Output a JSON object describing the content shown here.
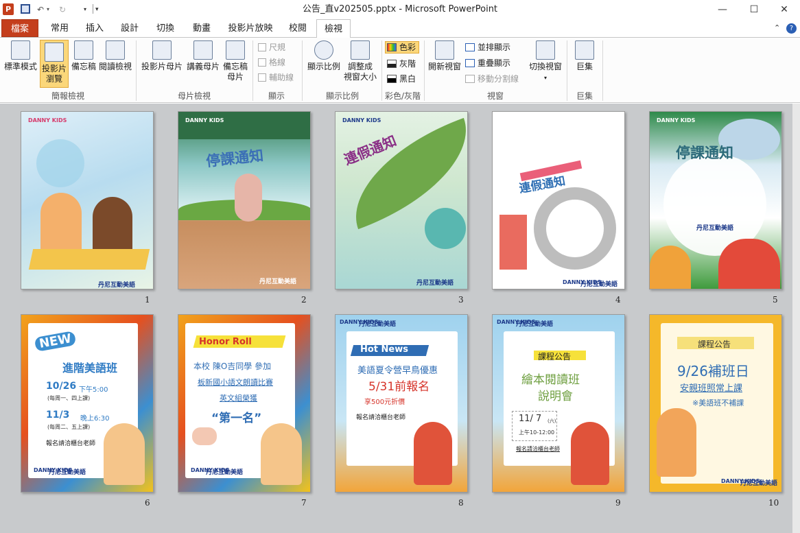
{
  "titlebar": {
    "title": "公告_直v202505.pptx  -  Microsoft PowerPoint",
    "minimize": "—",
    "maximize": "☐",
    "close": "✕"
  },
  "tabs": [
    {
      "label": "檔案"
    },
    {
      "label": "常用"
    },
    {
      "label": "插入"
    },
    {
      "label": "設計"
    },
    {
      "label": "切換"
    },
    {
      "label": "動畫"
    },
    {
      "label": "投影片放映"
    },
    {
      "label": "校閱"
    },
    {
      "label": "檢視"
    }
  ],
  "ribbon": {
    "presentation_views": {
      "label": "簡報檢視",
      "normal": "標準模式",
      "sorter_line1": "投影片",
      "sorter_line2": "瀏覽",
      "notes": "備忘稿",
      "reading": "閱讀檢視"
    },
    "master_views": {
      "label": "母片檢視",
      "slide_master": "投影片母片",
      "handout_master": "講義母片",
      "notes_master_line1": "備忘稿",
      "notes_master_line2": "母片"
    },
    "show": {
      "label": "顯示",
      "ruler": "尺規",
      "gridlines": "格線",
      "guides": "輔助線"
    },
    "zoom": {
      "label": "顯示比例",
      "zoom": "顯示比例",
      "fit_line1": "調整成",
      "fit_line2": "視窗大小"
    },
    "color": {
      "label": "彩色/灰階",
      "color": "色彩",
      "grayscale": "灰階",
      "bw": "黑白"
    },
    "window": {
      "label": "視窗",
      "new_window": "開新視窗",
      "arrange_all": "並排顯示",
      "cascade": "重疊顯示",
      "move_split": "移動分割線",
      "switch": "切換視窗"
    },
    "macros": {
      "label": "巨集",
      "macros": "巨集"
    }
  },
  "slides": [
    {
      "num": "1",
      "brand": "丹尼互動美語",
      "logo": "DANNY KIDS"
    },
    {
      "num": "2",
      "title": "停課通知",
      "brand": "丹尼互動美語",
      "logo": "DANNY KIDS"
    },
    {
      "num": "3",
      "title": "連假通知",
      "brand": "丹尼互動美語",
      "logo": "DANNY KIDS"
    },
    {
      "num": "4",
      "title": "連假通知",
      "brand": "丹尼互動美語",
      "logo": "DANNY KIDS"
    },
    {
      "num": "5",
      "title": "停課通知",
      "brand": "丹尼互動美語",
      "logo": "DANNY KIDS"
    },
    {
      "num": "6",
      "badge": "NEW",
      "title": "進階美語班",
      "line1_date": "10/26",
      "line1_time": "下午5:00",
      "line1_note": "(每周一、四上課)",
      "line2_date": "11/3",
      "line2_time": "晚上6:30",
      "line2_note": "(每周二、五上課)",
      "contact": "報名請洽櫃台老師",
      "brand": "丹尼互動美語",
      "logo": "DANNY KIDS"
    },
    {
      "num": "7",
      "badge": "Honor Roll",
      "line1": "本校 陳O吉同學 參加",
      "line2": "板新國小語文朗讀比賽",
      "line3": "英文組榮獲",
      "line4": "“第一名”",
      "brand": "丹尼互動美語",
      "logo": "DANNY KIDS"
    },
    {
      "num": "8",
      "badge": "Hot News",
      "line1": "美語夏令營早鳥優惠",
      "line2": "5/31前報名",
      "line3": "享500元折價",
      "line4": "報名請洽櫃台老師",
      "brand": "丹尼互動美語",
      "logo": "DANNY KIDS"
    },
    {
      "num": "9",
      "badge": "課程公告",
      "line1": "繪本閱讀班",
      "line2": "說明會",
      "date": "11/ 7",
      "dow": "(六)",
      "time": "上午10-12:00",
      "contact": "報名請洽櫃台老師",
      "brand": "丹尼互動美語",
      "logo": "DANNY KIDS"
    },
    {
      "num": "10",
      "badge": "課程公告",
      "line1": "9/26補班日",
      "line2": "安親班照常上課",
      "line3": "※美語班不補課",
      "brand": "丹尼互動美語",
      "logo": "DANNY KIDS"
    }
  ]
}
